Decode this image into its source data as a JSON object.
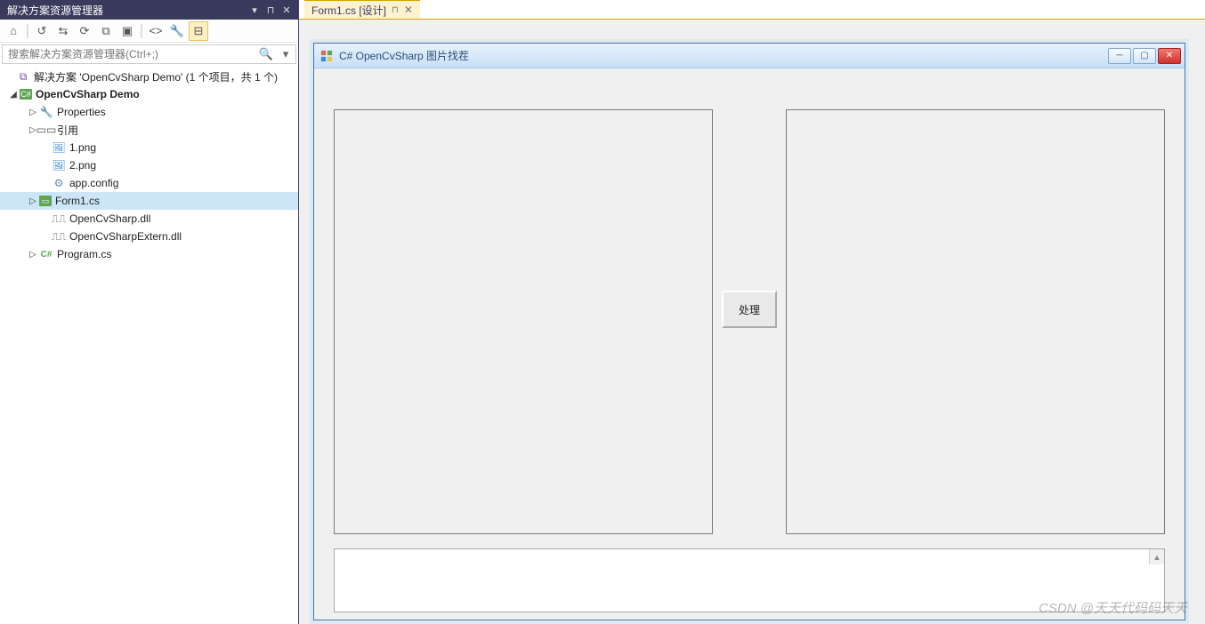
{
  "panel": {
    "title": "解决方案资源管理器"
  },
  "search": {
    "placeholder": "搜索解决方案资源管理器(Ctrl+;)"
  },
  "tree": {
    "solution_label": "解决方案 'OpenCvSharp Demo' (1 个项目，共 1 个)",
    "project_label": "OpenCvSharp Demo",
    "items": [
      {
        "label": "Properties",
        "icon": "wrench",
        "expander": "▷"
      },
      {
        "label": "引用",
        "icon": "ref",
        "expander": "▷"
      },
      {
        "label": "1.png",
        "icon": "img",
        "expander": ""
      },
      {
        "label": "2.png",
        "icon": "img",
        "expander": ""
      },
      {
        "label": "app.config",
        "icon": "config",
        "expander": ""
      },
      {
        "label": "Form1.cs",
        "icon": "cs",
        "expander": "▷",
        "selected": true
      },
      {
        "label": "OpenCvSharp.dll",
        "icon": "dll",
        "expander": ""
      },
      {
        "label": "OpenCvSharpExtern.dll",
        "icon": "dll",
        "expander": ""
      },
      {
        "label": "Program.cs",
        "icon": "cshash",
        "expander": "▷"
      }
    ]
  },
  "tab": {
    "label": "Form1.cs [设计]"
  },
  "form": {
    "title": "C# OpenCvSharp  图片找茬",
    "process_btn": "处理"
  },
  "watermark": "CSDN @天天代码码天天"
}
